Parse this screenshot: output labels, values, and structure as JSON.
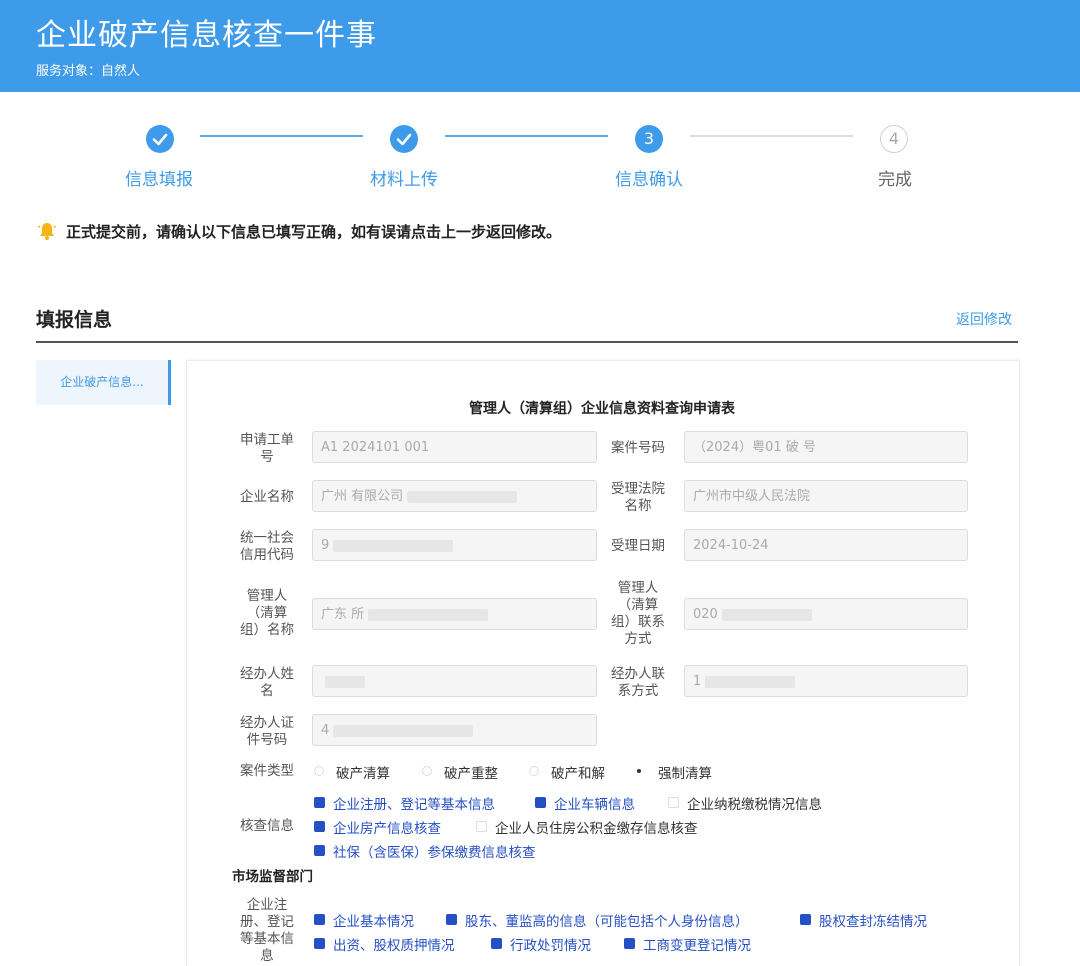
{
  "header": {
    "title": "企业破产信息核查一件事",
    "subtitle": "服务对象：自然人"
  },
  "steps": [
    {
      "label": "信息填报",
      "state": "done"
    },
    {
      "label": "材料上传",
      "state": "done"
    },
    {
      "label": "信息确认",
      "state": "current",
      "number": "3"
    },
    {
      "label": "完成",
      "state": "pending",
      "number": "4"
    }
  ],
  "notice": "正式提交前，请确认以下信息已填写正确，如有误请点击上一步返回修改。",
  "section": {
    "title": "填报信息",
    "back_link": "返回修改",
    "side_tab": "企业破产信息..."
  },
  "form": {
    "title": "管理人（清算组）企业信息资料查询申请表",
    "fields": {
      "order_no": {
        "label": "申请工单号",
        "value": "A1 2024101 001"
      },
      "case_no": {
        "label": "案件号码",
        "value": "（2024）粤01 破 号"
      },
      "company": {
        "label": "企业名称",
        "value": "广州 有限公司"
      },
      "court": {
        "label": "受理法院名称",
        "value": "广州市中级人民法院"
      },
      "credit_code": {
        "label": "统一社会信用代码",
        "value": "9"
      },
      "accept_date": {
        "label": "受理日期",
        "value": "2024-10-24"
      },
      "manager_name": {
        "label": "管理人（清算组）名称",
        "value": "广东 所"
      },
      "manager_contact": {
        "label": "管理人（清算组）联系方式",
        "value": "020"
      },
      "agent_name": {
        "label": "经办人姓名",
        "value": ""
      },
      "agent_contact": {
        "label": "经办人联系方式",
        "value": "1"
      },
      "agent_id": {
        "label": "经办人证件号码",
        "value": "4"
      }
    },
    "case_type": {
      "label": "案件类型",
      "options": [
        "破产清算",
        "破产重整",
        "破产和解",
        "强制清算"
      ],
      "selected": "强制清算"
    },
    "check_info": {
      "label": "核查信息",
      "items": [
        {
          "label": "企业注册、登记等基本信息",
          "checked": true
        },
        {
          "label": "企业车辆信息",
          "checked": true
        },
        {
          "label": "企业纳税缴税情况信息",
          "checked": false
        },
        {
          "label": "企业房产信息核查",
          "checked": true
        },
        {
          "label": "企业人员住房公积金缴存信息核查",
          "checked": false
        },
        {
          "label": "社保（含医保）参保缴费信息核查",
          "checked": true
        }
      ]
    },
    "market_dept": {
      "heading": "市场监督部门",
      "label": "企业注册、登记等基本信息",
      "items": [
        {
          "label": "企业基本情况",
          "checked": true
        },
        {
          "label": "股东、董监高的信息（可能包括个人身份信息）",
          "checked": true
        },
        {
          "label": "股权查封冻结情况",
          "checked": true
        },
        {
          "label": "出资、股权质押情况",
          "checked": true
        },
        {
          "label": "行政处罚情况",
          "checked": true
        },
        {
          "label": "工商变更登记情况",
          "checked": true
        }
      ]
    }
  },
  "colors": {
    "primary": "#3d9be9",
    "checkbox": "#2550c4"
  }
}
